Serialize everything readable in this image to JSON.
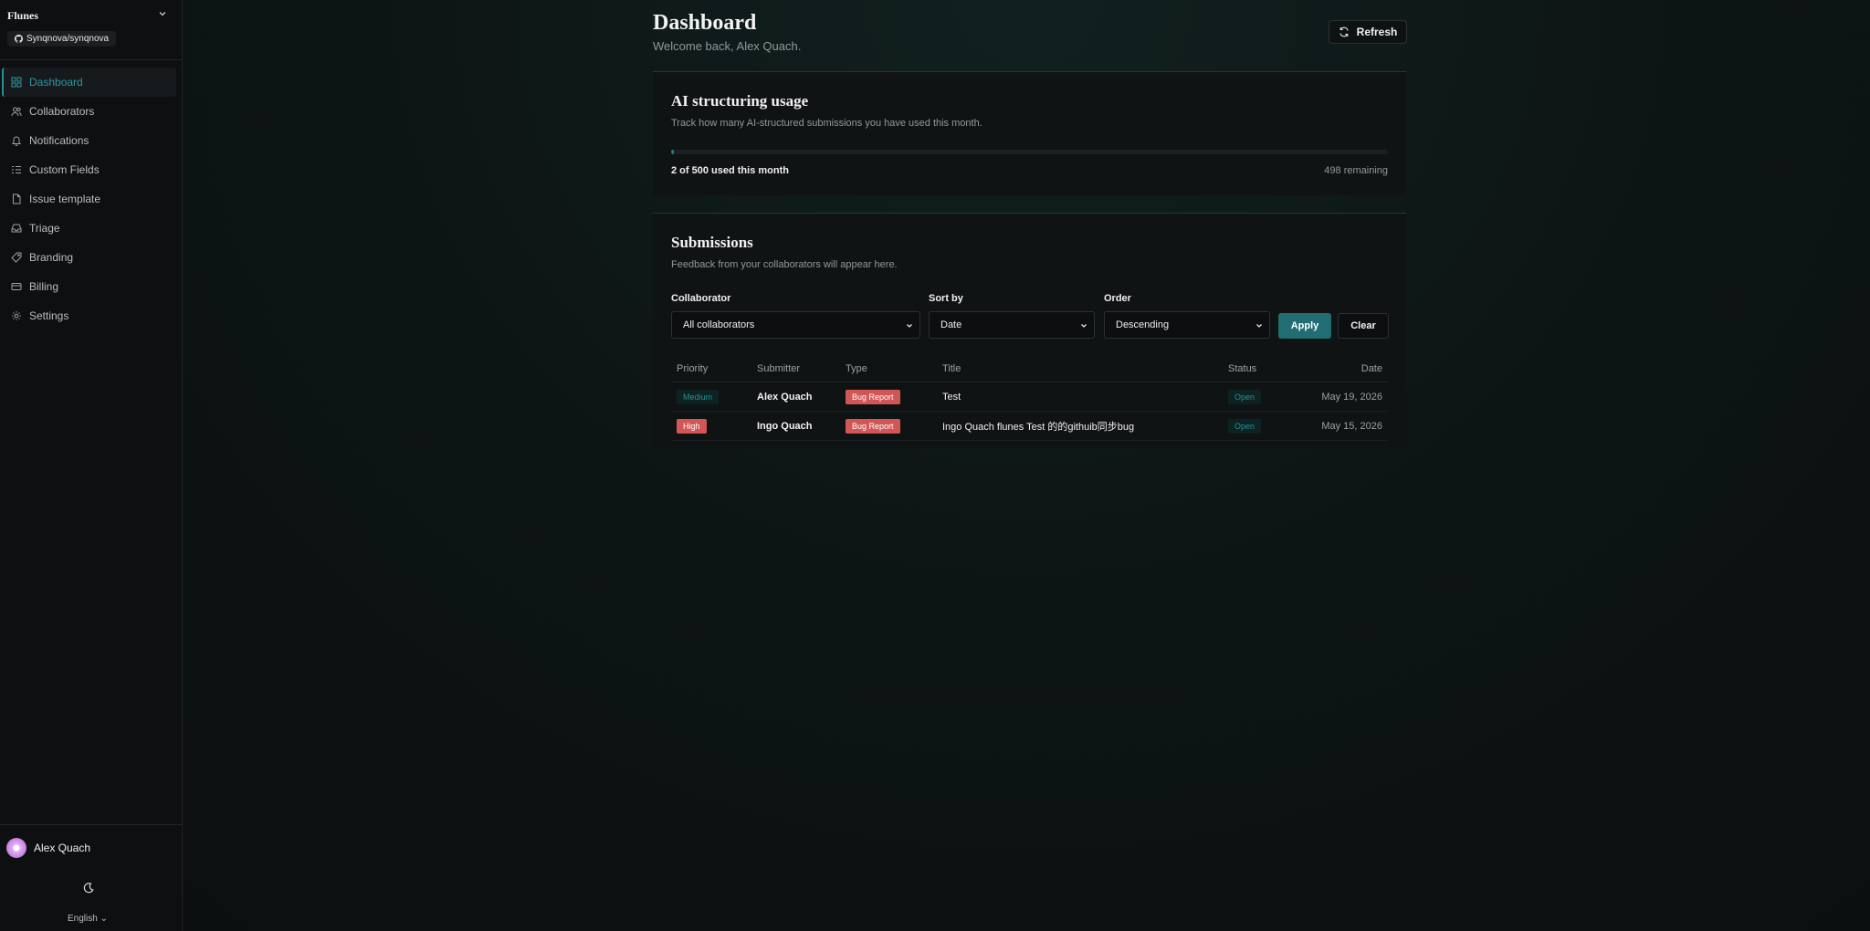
{
  "sidebar": {
    "workspace": "Flunes",
    "repo": "Synqnova/synqnova",
    "items": [
      {
        "label": "Dashboard",
        "icon": "dashboard-icon"
      },
      {
        "label": "Collaborators",
        "icon": "users-icon"
      },
      {
        "label": "Notifications",
        "icon": "bell-icon"
      },
      {
        "label": "Custom Fields",
        "icon": "list-icon"
      },
      {
        "label": "Issue template",
        "icon": "file-icon"
      },
      {
        "label": "Triage",
        "icon": "inbox-icon"
      },
      {
        "label": "Branding",
        "icon": "tag-icon"
      },
      {
        "label": "Billing",
        "icon": "card-icon"
      },
      {
        "label": "Settings",
        "icon": "gear-icon"
      }
    ],
    "user": "Alex Quach",
    "language": "English"
  },
  "header": {
    "title": "Dashboard",
    "subtitle": "Welcome back, Alex Quach.",
    "refresh": "Refresh"
  },
  "usage": {
    "title": "AI structuring usage",
    "description": "Track how many AI-structured submissions you have used this month.",
    "used": 2,
    "total": 500,
    "used_text": "2 of 500 used this month",
    "remaining_text": "498 remaining"
  },
  "submissions": {
    "title": "Submissions",
    "description": "Feedback from your collaborators will appear here.",
    "filters": {
      "collaborator_label": "Collaborator",
      "collaborator_value": "All collaborators",
      "sort_label": "Sort by",
      "sort_value": "Date",
      "order_label": "Order",
      "order_value": "Descending",
      "apply": "Apply",
      "clear": "Clear"
    },
    "columns": [
      "Priority",
      "Submitter",
      "Type",
      "Title",
      "Status",
      "Date"
    ],
    "rows": [
      {
        "priority": "Medium",
        "submitter": "Alex Quach",
        "type": "Bug Report",
        "title": "Test",
        "status": "Open",
        "date": "May 19, 2026"
      },
      {
        "priority": "High",
        "submitter": "Ingo Quach",
        "type": "Bug Report",
        "title": "Ingo Quach flunes Test 的的githuib同步bug",
        "status": "Open",
        "date": "May 15, 2026"
      }
    ]
  },
  "colors": {
    "accent": "#2a8f95",
    "danger": "#d35656",
    "apply": "#216d73"
  }
}
